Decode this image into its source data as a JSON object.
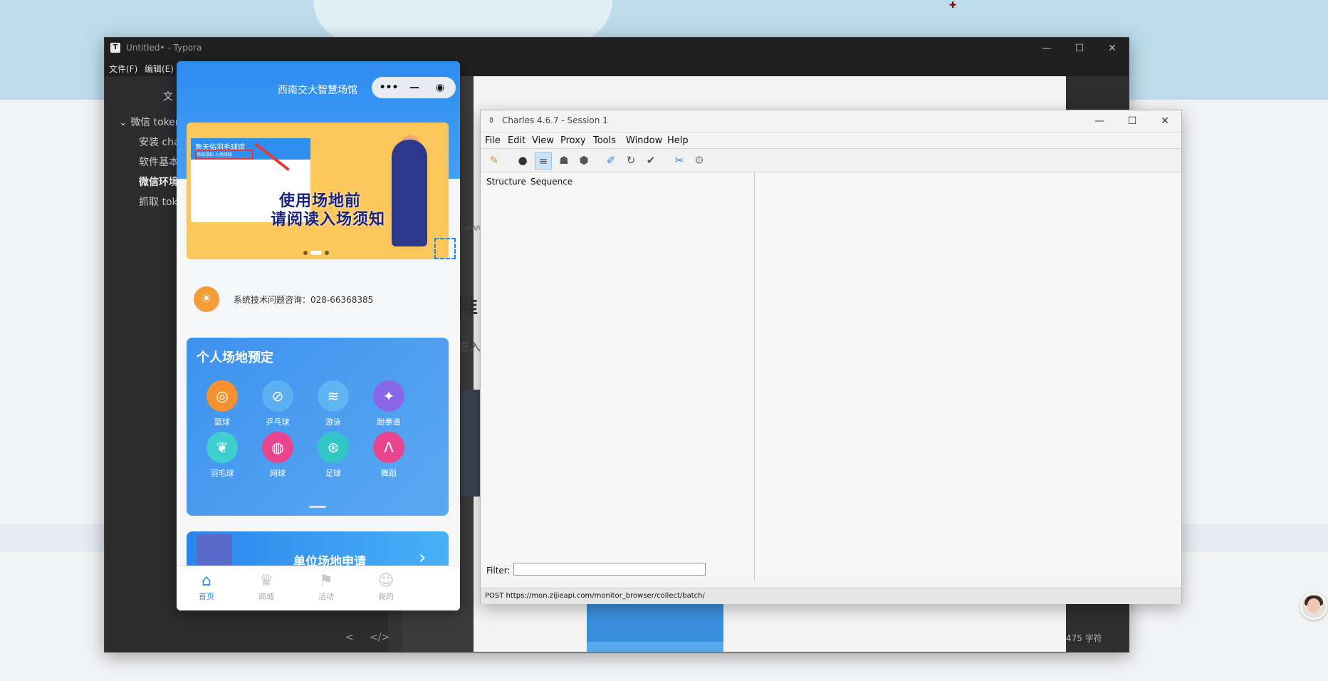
{
  "colors": {
    "accent": "#2f8cf0",
    "charles_bg": "#f4f4f4",
    "typora_bg": "#2b2b2b"
  },
  "typora": {
    "title": "Untitled• - Typora",
    "menu": [
      "文件(F)",
      "编辑(E)"
    ],
    "sidebar_items": [
      "文",
      "微信 token",
      "安装 cha",
      "软件基本",
      "微信环境",
      "抓取 toke"
    ],
    "doc_text": [
      "准",
      "进入",
      "com/v"
    ],
    "word_count": "475 字符",
    "nav_prev": "<",
    "nav_source": "</>"
  },
  "mini_program": {
    "title": "西南交大智慧场馆",
    "capsule": [
      "•••",
      "—",
      "◉"
    ],
    "banner": {
      "venue": "詹天佑羽毛球馆",
      "notice": "场馆须知 入场须知",
      "headline_1": "使用场地前",
      "headline_2": "请阅读入场须知"
    },
    "support": "系统技术问题咨询：028-66368385",
    "booking": {
      "title": "个人场地预定",
      "sports": [
        {
          "label": "篮球",
          "icon": "basketball-icon",
          "color": "#f5922e",
          "glyph": "◎"
        },
        {
          "label": "乒乓球",
          "icon": "ping-pong-icon",
          "color": "#5ab0f0",
          "glyph": "⊘"
        },
        {
          "label": "游泳",
          "icon": "swimming-icon",
          "color": "#5fb4f2",
          "glyph": "≋"
        },
        {
          "label": "跆拳道",
          "icon": "taekwondo-icon",
          "color": "#8a67e8",
          "glyph": "✦"
        },
        {
          "label": "羽毛球",
          "icon": "badminton-icon",
          "color": "#3fcfcf",
          "glyph": "❦"
        },
        {
          "label": "网球",
          "icon": "tennis-icon",
          "color": "#e8458e",
          "glyph": "◍"
        },
        {
          "label": "足球",
          "icon": "football-icon",
          "color": "#33c6c6",
          "glyph": "⊛"
        },
        {
          "label": "舞蹈",
          "icon": "dance-icon",
          "color": "#e8458e",
          "glyph": "ᐱ"
        }
      ]
    },
    "unit_banner": "单位场地申请",
    "tabs": [
      {
        "label": "首页",
        "icon": "home-icon",
        "glyph": "⌂",
        "active": true
      },
      {
        "label": "商城",
        "icon": "crown-icon",
        "glyph": "♛",
        "active": false
      },
      {
        "label": "活动",
        "icon": "gift-icon",
        "glyph": "⚑",
        "active": false
      },
      {
        "label": "我的",
        "icon": "user-icon",
        "glyph": "☺",
        "active": false
      }
    ]
  },
  "charles": {
    "title": "Charles 4.6.7 - Session 1",
    "menu": [
      "File",
      "Edit",
      "View",
      "Proxy",
      "Tools",
      "Window",
      "Help"
    ],
    "tabs": [
      "Structure",
      "Sequence"
    ],
    "filter_label": "Filter:",
    "filter_value": "",
    "status": "POST https://mon.zijieapi.com/monitor_browser/collect/batch/"
  }
}
